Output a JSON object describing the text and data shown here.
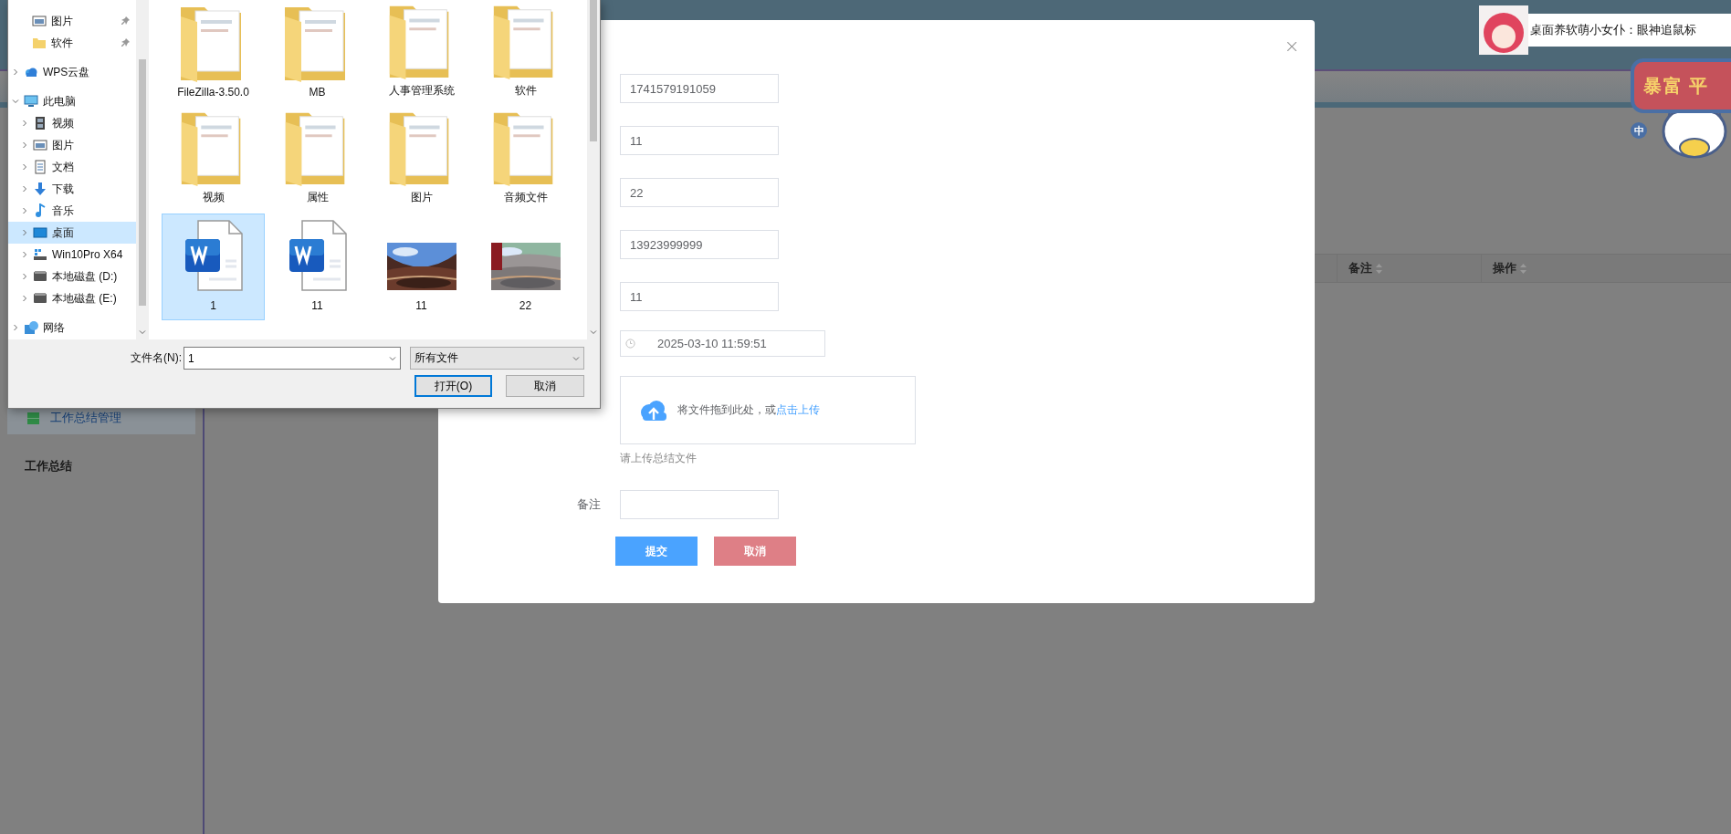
{
  "background": {
    "sidebar": {
      "items": [
        {
          "label": "工作总结管理",
          "selected": true
        }
      ],
      "section_title": "工作总结"
    },
    "table": {
      "columns": [
        {
          "label": "备注"
        },
        {
          "label": "操作"
        }
      ]
    }
  },
  "modal": {
    "fields": [
      {
        "value": "1741579191059"
      },
      {
        "value": "11"
      },
      {
        "value": "22"
      },
      {
        "value": "13923999999"
      },
      {
        "value": "11"
      }
    ],
    "datetime": {
      "value": "2025-03-10 11:59:51"
    },
    "upload": {
      "text": "将文件拖到此处，或",
      "link": "点击上传",
      "hint": "请上传总结文件"
    },
    "remark": {
      "label": "备注"
    },
    "buttons": [
      {
        "label": "提交",
        "kind": "primary"
      },
      {
        "label": "取消",
        "kind": "danger"
      }
    ]
  },
  "file_dialog": {
    "quick_access": [
      {
        "label": "图片",
        "kind": "pictures",
        "pinned": true
      },
      {
        "label": "软件",
        "kind": "folder",
        "pinned": true
      }
    ],
    "tree": [
      {
        "label": "WPS云盘",
        "kind": "cloud",
        "expanded": false,
        "selected": false
      },
      {
        "label": "此电脑",
        "kind": "pc",
        "expanded": true,
        "selected": false,
        "children": [
          {
            "label": "视频",
            "kind": "video",
            "expanded": false,
            "selected": false
          },
          {
            "label": "图片",
            "kind": "pictures",
            "expanded": false,
            "selected": false
          },
          {
            "label": "文档",
            "kind": "documents",
            "expanded": false,
            "selected": false
          },
          {
            "label": "下载",
            "kind": "download",
            "expanded": false,
            "selected": false
          },
          {
            "label": "音乐",
            "kind": "music",
            "expanded": false,
            "selected": false
          },
          {
            "label": "桌面",
            "kind": "desktop",
            "expanded": false,
            "selected": true
          },
          {
            "label": "Win10Pro X64",
            "kind": "system_drive",
            "expanded": false,
            "selected": false
          },
          {
            "label": "本地磁盘 (D:)",
            "kind": "drive",
            "expanded": false,
            "selected": false
          },
          {
            "label": "本地磁盘 (E:)",
            "kind": "drive",
            "expanded": false,
            "selected": false
          }
        ]
      },
      {
        "label": "网络",
        "kind": "network",
        "expanded": false,
        "selected": false
      }
    ],
    "files": [
      {
        "name": "FileZilla-3.50.0",
        "kind": "folder",
        "selected": false
      },
      {
        "name": "MB",
        "kind": "folder",
        "selected": false
      },
      {
        "name": "人事管理系统",
        "kind": "folder",
        "selected": false
      },
      {
        "name": "软件",
        "kind": "folder",
        "selected": false
      },
      {
        "name": "视频",
        "kind": "folder",
        "selected": false
      },
      {
        "name": "属性",
        "kind": "folder",
        "selected": false
      },
      {
        "name": "图片",
        "kind": "folder",
        "selected": false
      },
      {
        "name": "音频文件",
        "kind": "folder",
        "selected": false
      },
      {
        "name": "1",
        "kind": "document",
        "selected": true
      },
      {
        "name": "11",
        "kind": "document",
        "selected": false
      },
      {
        "name": "11",
        "selected": false
      },
      {
        "name": "22",
        "selected": false
      }
    ],
    "filename": {
      "label": "文件名(N):",
      "value": "1"
    },
    "file_type": "所有文件",
    "buttons": [
      {
        "label": "打开(O)",
        "kind": "default"
      },
      {
        "label": "取消",
        "kind": "normal"
      }
    ]
  },
  "notification": {
    "text": "桌面养软萌小女仆：眼神追鼠标"
  },
  "desk_pet": {
    "sign": [
      "暴富",
      "平"
    ],
    "badge": "中"
  }
}
